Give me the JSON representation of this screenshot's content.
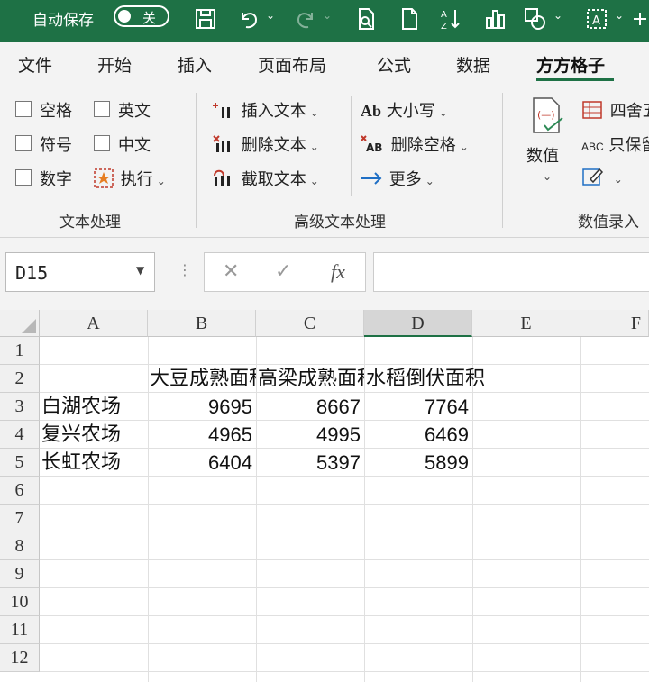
{
  "titlebar": {
    "autosave_label": "自动保存",
    "autosave_state": "关"
  },
  "tabs": [
    "文件",
    "开始",
    "插入",
    "页面布局",
    "公式",
    "数据",
    "方方格子"
  ],
  "active_tab": "方方格子",
  "ribbon": {
    "text_group": {
      "checks": [
        "空格",
        "英文",
        "符号",
        "中文",
        "数字"
      ],
      "execute": "执行",
      "label": "文本处理"
    },
    "advanced_group": {
      "insert_text": "插入文本",
      "delete_text": "删除文本",
      "extract_text": "截取文本",
      "case": "大小写",
      "case_icon": "Ab",
      "delete_spaces": "删除空格",
      "more": "更多",
      "label": "高级文本处理"
    },
    "data_entry_group": {
      "value": "数值",
      "round": "四舍五",
      "keep": "只保留",
      "keep_icon": "ABC",
      "label": "数值录入"
    }
  },
  "formula_bar": {
    "name_box": "D15",
    "fx": "fx",
    "formula": ""
  },
  "sheet": {
    "columns": [
      "A",
      "B",
      "C",
      "D",
      "E",
      "F"
    ],
    "selected_column": "D",
    "rows": [
      "1",
      "2",
      "3",
      "4",
      "5",
      "6",
      "7",
      "8",
      "9",
      "10",
      "11",
      "12"
    ],
    "headers": [
      "大豆成熟面积",
      "高梁成熟面积",
      "水稻倒伏面积"
    ],
    "data": [
      {
        "farm": "白湖农场",
        "values": [
          "9695",
          "8667",
          "7764"
        ]
      },
      {
        "farm": "复兴农场",
        "values": [
          "4965",
          "4995",
          "6469"
        ]
      },
      {
        "farm": "长虹农场",
        "values": [
          "6404",
          "5397",
          "5899"
        ]
      }
    ]
  }
}
